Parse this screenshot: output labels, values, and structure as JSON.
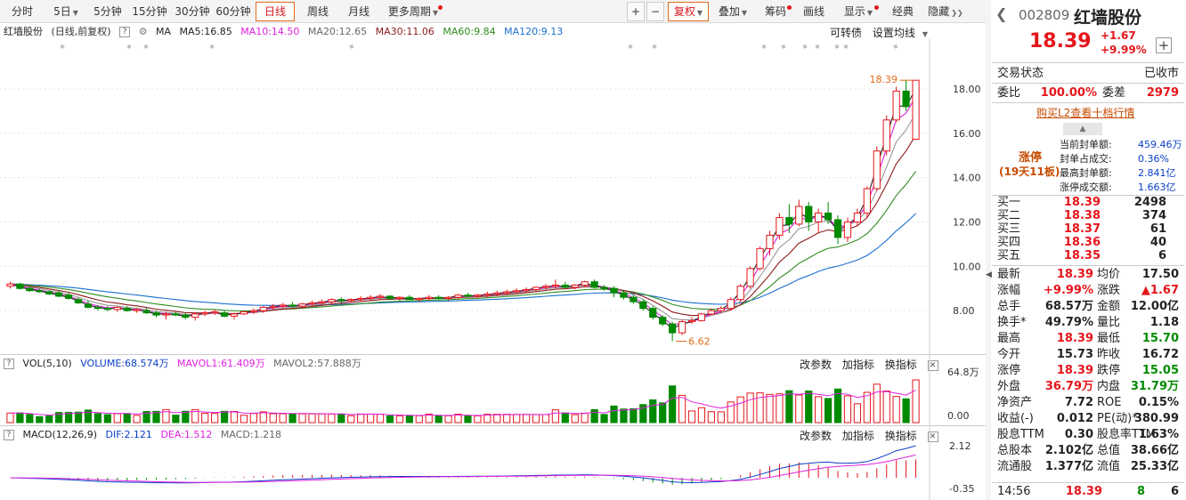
{
  "toolbar": {
    "items": [
      "分时",
      "5日",
      "5分钟",
      "15分钟",
      "30分钟",
      "60分钟",
      "日线",
      "周线",
      "月线",
      "更多周期"
    ],
    "active": "日线",
    "plus": "+",
    "minus": "−",
    "rights": "复权",
    "overlay": "叠加",
    "chips": "筹码",
    "draw": "画线",
    "display": "显示",
    "classic": "经典",
    "hide": "隐藏"
  },
  "main": {
    "name": "红墙股份",
    "mode": "(日线,前复权)",
    "help": "?",
    "ma_label": "MA",
    "ma5": "MA5:16.85",
    "ma10": "MA10:14.50",
    "ma20": "MA20:12.65",
    "ma30": "MA30:11.06",
    "ma60": "MA60:9.84",
    "ma120": "MA120:9.13",
    "convert": "可转债",
    "setma": "设置均线",
    "high_label": "18.39",
    "low_label": "6.62",
    "yaxis": [
      "18.00",
      "16.00",
      "14.00",
      "12.00",
      "10.00",
      "8.00"
    ]
  },
  "vol": {
    "label": "VOL(5,10)",
    "volume": "VOLUME:68.574万",
    "mavol1": "MAVOL1:61.409万",
    "mavol2": "MAVOL2:57.888万",
    "params": "改参数",
    "add": "加指标",
    "swap": "换指标",
    "yaxis": [
      "64.8万",
      "0.00"
    ]
  },
  "macd": {
    "label": "MACD(12,26,9)",
    "dif": "DIF:2.121",
    "dea": "DEA:1.512",
    "macd": "MACD:1.218",
    "params": "改参数",
    "add": "加指标",
    "swap": "换指标",
    "yaxis": [
      "2.12",
      "-0.35"
    ]
  },
  "quote": {
    "code": "002809",
    "name": "红墙股份",
    "price": "18.39",
    "change": "+1.67",
    "pct": "+9.99%",
    "add": "+",
    "status_label": "交易状态",
    "status": "已收市",
    "wb_label": "委比",
    "wb": "100.00%",
    "wc_label": "委差",
    "wc": "2979",
    "l2": "购买L2查看十档行情",
    "limit_title": "涨停",
    "limit_sub": "(19天11板)",
    "seal": [
      {
        "k": "当前封单额:",
        "v": "459.46万"
      },
      {
        "k": "封单占成交:",
        "v": "0.36%"
      },
      {
        "k": "最高封单额:",
        "v": "2.841亿"
      },
      {
        "k": "涨停成交额:",
        "v": "1.663亿"
      }
    ],
    "bids": [
      {
        "k": "买一",
        "p": "18.39",
        "v": "2498"
      },
      {
        "k": "买二",
        "p": "18.38",
        "v": "374"
      },
      {
        "k": "买三",
        "p": "18.37",
        "v": "61"
      },
      {
        "k": "买四",
        "p": "18.36",
        "v": "40"
      },
      {
        "k": "买五",
        "p": "18.35",
        "v": "6"
      }
    ],
    "stats": [
      [
        "最新",
        "18.39",
        "均价",
        "17.50"
      ],
      [
        "涨幅",
        "+9.99%",
        "涨跌",
        "▲1.67"
      ],
      [
        "总手",
        "68.57万",
        "金额",
        "12.00亿"
      ],
      [
        "换手*",
        "49.79%",
        "量比",
        "1.18"
      ],
      [
        "最高",
        "18.39",
        "最低",
        "15.70"
      ],
      [
        "今开",
        "15.73",
        "昨收",
        "16.72"
      ],
      [
        "涨停",
        "18.39",
        "跌停",
        "15.05"
      ],
      [
        "外盘",
        "36.79万",
        "内盘",
        "31.79万"
      ],
      [
        "净资产",
        "7.72",
        "ROE",
        "0.15%"
      ],
      [
        "收益(-)",
        "0.012",
        "PE(动)*",
        "380.99"
      ],
      [
        "股息TTM",
        "0.30",
        "股息率TTM",
        "1.63%"
      ],
      [
        "总股本",
        "2.102亿",
        "总值",
        "38.66亿"
      ],
      [
        "流通股",
        "1.377亿",
        "流值",
        "25.33亿"
      ]
    ],
    "tick": {
      "time": "14:56",
      "price": "18.39",
      "vol": "8",
      "count": "6"
    }
  },
  "colors": {
    "up": "#e4161b",
    "down": "#008a00",
    "ma5": "#222222",
    "ma10": "#e020e0",
    "ma20": "#999999",
    "ma30": "#8b1a1a",
    "ma60": "#2e8b1e",
    "ma120": "#1a6fd0",
    "accent": "#e06a1a"
  },
  "chart_data": {
    "type": "candlestick",
    "ylim": [
      6.2,
      19.2
    ],
    "current": 18.39,
    "high": 18.39,
    "low": 6.62,
    "ohlc": [
      [
        9.1,
        9.3,
        9.0,
        9.2
      ],
      [
        9.2,
        9.25,
        8.95,
        9.0
      ],
      [
        9.0,
        9.1,
        8.85,
        8.9
      ],
      [
        8.9,
        8.98,
        8.8,
        8.85
      ],
      [
        8.85,
        8.9,
        8.7,
        8.75
      ],
      [
        8.8,
        8.9,
        8.6,
        8.65
      ],
      [
        8.7,
        8.8,
        8.5,
        8.55
      ],
      [
        8.5,
        8.6,
        8.3,
        8.35
      ],
      [
        8.3,
        8.45,
        8.1,
        8.15
      ],
      [
        8.15,
        8.25,
        8.0,
        8.1
      ],
      [
        8.1,
        8.2,
        7.98,
        8.05
      ],
      [
        8.05,
        8.2,
        7.95,
        8.15
      ],
      [
        8.1,
        8.2,
        7.95,
        8.0
      ],
      [
        8.0,
        8.1,
        7.9,
        8.05
      ],
      [
        8.0,
        8.15,
        7.85,
        7.9
      ],
      [
        7.9,
        8.0,
        7.7,
        7.8
      ],
      [
        7.8,
        7.95,
        7.6,
        7.85
      ],
      [
        7.85,
        7.95,
        7.75,
        7.8
      ],
      [
        7.8,
        7.9,
        7.6,
        7.7
      ],
      [
        7.7,
        7.9,
        7.55,
        7.85
      ],
      [
        7.85,
        8.0,
        7.75,
        7.9
      ],
      [
        7.9,
        8.05,
        7.8,
        7.95
      ],
      [
        7.9,
        8.0,
        7.7,
        7.75
      ],
      [
        7.75,
        7.9,
        7.6,
        7.85
      ],
      [
        7.85,
        8.0,
        7.8,
        7.95
      ],
      [
        7.95,
        8.1,
        7.85,
        8.0
      ],
      [
        8.0,
        8.2,
        7.9,
        8.15
      ],
      [
        8.15,
        8.3,
        8.05,
        8.2
      ],
      [
        8.2,
        8.35,
        8.1,
        8.25
      ],
      [
        8.25,
        8.4,
        8.15,
        8.2
      ],
      [
        8.2,
        8.35,
        8.1,
        8.3
      ],
      [
        8.3,
        8.45,
        8.2,
        8.35
      ],
      [
        8.35,
        8.5,
        8.25,
        8.4
      ],
      [
        8.4,
        8.55,
        8.3,
        8.5
      ],
      [
        8.5,
        8.6,
        8.35,
        8.45
      ],
      [
        8.45,
        8.55,
        8.35,
        8.5
      ],
      [
        8.5,
        8.65,
        8.4,
        8.55
      ],
      [
        8.55,
        8.7,
        8.45,
        8.6
      ],
      [
        8.6,
        8.75,
        8.5,
        8.65
      ],
      [
        8.65,
        8.7,
        8.5,
        8.55
      ],
      [
        8.55,
        8.65,
        8.45,
        8.6
      ],
      [
        8.6,
        8.7,
        8.5,
        8.5
      ],
      [
        8.5,
        8.6,
        8.4,
        8.55
      ],
      [
        8.55,
        8.7,
        8.45,
        8.6
      ],
      [
        8.6,
        8.7,
        8.5,
        8.55
      ],
      [
        8.55,
        8.65,
        8.45,
        8.6
      ],
      [
        8.6,
        8.75,
        8.5,
        8.7
      ],
      [
        8.7,
        8.8,
        8.6,
        8.65
      ],
      [
        8.65,
        8.75,
        8.55,
        8.7
      ],
      [
        8.7,
        8.85,
        8.6,
        8.75
      ],
      [
        8.75,
        8.9,
        8.65,
        8.8
      ],
      [
        8.8,
        8.95,
        8.7,
        8.85
      ],
      [
        8.85,
        9.0,
        8.75,
        8.9
      ],
      [
        8.9,
        9.05,
        8.8,
        8.95
      ],
      [
        8.95,
        9.1,
        8.85,
        9.05
      ],
      [
        9.05,
        9.2,
        8.95,
        9.1
      ],
      [
        9.1,
        9.4,
        9.0,
        9.15
      ],
      [
        9.15,
        9.3,
        9.0,
        9.05
      ],
      [
        9.05,
        9.2,
        8.95,
        9.15
      ],
      [
        9.15,
        9.35,
        9.05,
        9.3
      ],
      [
        9.3,
        9.4,
        9.0,
        9.05
      ],
      [
        9.05,
        9.15,
        8.9,
        9.0
      ],
      [
        9.0,
        9.1,
        8.6,
        8.8
      ],
      [
        8.8,
        8.9,
        8.5,
        8.6
      ],
      [
        8.6,
        8.7,
        8.3,
        8.4
      ],
      [
        8.4,
        8.5,
        8.0,
        8.1
      ],
      [
        8.1,
        8.2,
        7.6,
        7.7
      ],
      [
        7.7,
        7.8,
        7.3,
        7.4
      ],
      [
        7.4,
        7.5,
        6.62,
        7.0
      ],
      [
        7.0,
        7.6,
        6.9,
        7.5
      ],
      [
        7.5,
        7.7,
        7.4,
        7.55
      ],
      [
        7.55,
        7.9,
        7.5,
        7.85
      ],
      [
        7.85,
        8.1,
        7.8,
        8.0
      ],
      [
        8.0,
        8.2,
        7.9,
        8.1
      ],
      [
        8.1,
        8.6,
        8.0,
        8.5
      ],
      [
        8.5,
        9.2,
        8.4,
        9.1
      ],
      [
        9.1,
        10.0,
        9.0,
        9.9
      ],
      [
        9.9,
        10.9,
        9.8,
        10.8
      ],
      [
        10.8,
        11.6,
        10.5,
        11.4
      ],
      [
        11.4,
        12.4,
        11.2,
        12.2
      ],
      [
        12.2,
        12.8,
        11.5,
        11.9
      ],
      [
        11.9,
        13.0,
        11.8,
        12.7
      ],
      [
        12.7,
        12.9,
        11.6,
        12.0
      ],
      [
        12.0,
        12.6,
        11.5,
        12.4
      ],
      [
        12.4,
        12.9,
        11.9,
        12.1
      ],
      [
        12.1,
        12.3,
        11.0,
        11.3
      ],
      [
        11.3,
        12.2,
        11.1,
        12.0
      ],
      [
        12.0,
        12.6,
        11.8,
        12.4
      ],
      [
        12.4,
        13.6,
        12.2,
        13.5
      ],
      [
        13.5,
        15.4,
        13.4,
        15.2
      ],
      [
        15.2,
        16.8,
        15.0,
        16.6
      ],
      [
        16.6,
        18.1,
        16.5,
        17.9
      ],
      [
        17.9,
        18.4,
        17.0,
        17.2
      ],
      [
        15.73,
        18.39,
        15.7,
        18.39
      ]
    ],
    "ma": {
      "MA5": 16.85,
      "MA10": 14.5,
      "MA20": 12.65,
      "MA30": 11.06,
      "MA60": 9.84,
      "MA120": 9.13
    }
  }
}
